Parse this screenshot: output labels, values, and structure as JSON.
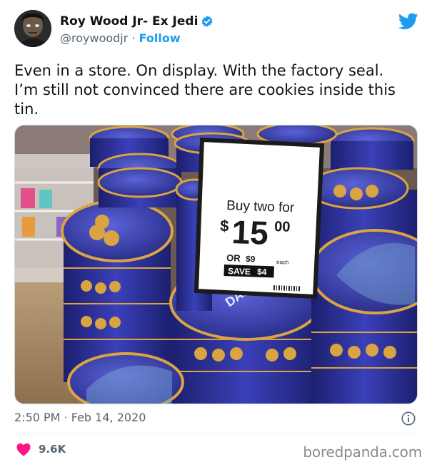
{
  "author": {
    "display_name": "Roy Wood Jr- Ex Jedi",
    "handle": "@roywoodjr",
    "separator": "·",
    "follow_label": "Follow",
    "verified_icon": "verified-badge-icon",
    "brand_icon": "twitter-bird-icon"
  },
  "tweet": {
    "text": "Even in a store. On display. With the factory seal.\nI’m still not convinced there are cookies inside this\ntin."
  },
  "photo": {
    "sign": {
      "line1": "Buy two for",
      "dollar": "$",
      "price_main": "15",
      "price_cents": "00",
      "or_label": "OR",
      "single_price": "$9",
      "each_label": "each",
      "save_label": "SAVE",
      "save_amount": "$4"
    },
    "tin_brand": "DANSK"
  },
  "meta": {
    "time": "2:50 PM",
    "separator": "·",
    "date": "Feb 14, 2020",
    "info_icon": "info-icon"
  },
  "stats": {
    "likes": "9.6K",
    "heart_icon": "heart-icon"
  },
  "watermark": "boredpanda.com",
  "colors": {
    "accent": "#1d9bf0",
    "heart": "#f91880",
    "tin_blue": "#2a2f9a",
    "tin_gold": "#d9a441"
  }
}
